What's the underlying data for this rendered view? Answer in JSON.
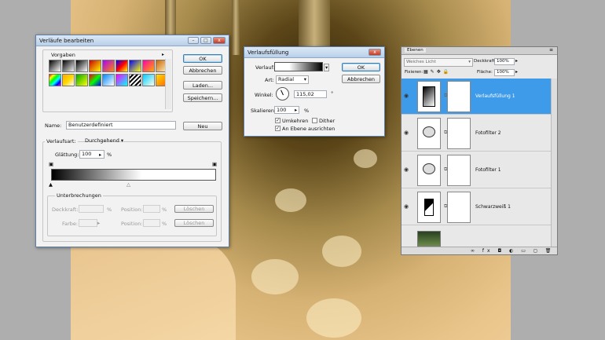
{
  "verlaeufe": {
    "title": "Verläufe bearbeiten",
    "presets_label": "Vorgaben",
    "ok": "OK",
    "cancel": "Abbrechen",
    "load": "Laden...",
    "save": "Speichern...",
    "name_label": "Name:",
    "name_value": "Benutzerdefiniert",
    "new": "Neu",
    "type_label": "Verlaufsart:",
    "type_value": "Durchgehend",
    "smooth_label": "Glättung:",
    "smooth_value": "100",
    "smooth_unit": "%",
    "stops_label": "Unterbrechungen",
    "opacity_label": "Deckkraft:",
    "opacity_unit": "%",
    "position_label1": "Position:",
    "position_unit1": "%",
    "delete1": "Löschen",
    "color_label": "Farbe:",
    "position_label2": "Position:",
    "position_unit2": "%",
    "delete2": "Löschen",
    "swatches": [
      "linear-gradient(135deg,#000,#fff)",
      "linear-gradient(135deg,#000,rgba(0,0,0,0))",
      "linear-gradient(135deg,#000,#fff)",
      "linear-gradient(135deg,#c00,#ff0)",
      "linear-gradient(135deg,#a0f,#f80)",
      "linear-gradient(135deg,#00f,#f00,#ff0)",
      "linear-gradient(135deg,#00f,#ff0)",
      "linear-gradient(135deg,#f0a,#fa0)",
      "linear-gradient(135deg,#c60,#fff0c0)",
      "linear-gradient(135deg,#f00,#ff0,#0f0,#0ff,#00f,#f0f)",
      "linear-gradient(135deg,#fa0,#ffd700,#fff)",
      "linear-gradient(135deg,#0a0,#ff0)",
      "linear-gradient(135deg,#f00,#0f0,#00f)",
      "linear-gradient(135deg,#08f,#fff)",
      "linear-gradient(135deg,#f0f,#0ff)",
      "repeating-linear-gradient(135deg,#fff 0 2px,#000 2px 4px)",
      "linear-gradient(135deg,#0cf,#ffe)",
      "linear-gradient(135deg,#fd0,#f60)"
    ]
  },
  "verlaufsfuellung": {
    "title": "Verlaufsfüllung",
    "gradient_label": "Verlauf:",
    "style_label": "Art:",
    "style_value": "Radial",
    "angle_label": "Winkel:",
    "angle_value": "115,02",
    "angle_unit": "°",
    "scale_label": "Skalieren:",
    "scale_value": "100",
    "scale_unit": "%",
    "reverse_label": "Umkehren",
    "dither_label": "Dither",
    "align_label": "An Ebene ausrichten",
    "ok": "OK",
    "cancel": "Abbrechen",
    "reverse_checked": true,
    "dither_checked": false,
    "align_checked": true
  },
  "layers": {
    "tab": "Ebenen",
    "blend_mode": "Weiches Licht",
    "opacity_label": "Deckkraft:",
    "opacity_value": "100%",
    "lock_label": "Fixieren:",
    "fill_label": "Fläche:",
    "fill_value": "100%",
    "items": [
      {
        "name": "Verlaufsfüllung 1",
        "selected": true
      },
      {
        "name": "Fotofilter 2",
        "selected": false
      },
      {
        "name": "Fotofilter 1",
        "selected": false
      },
      {
        "name": "Schwarzweiß 1",
        "selected": false
      }
    ],
    "accent": "#3d9be9"
  }
}
